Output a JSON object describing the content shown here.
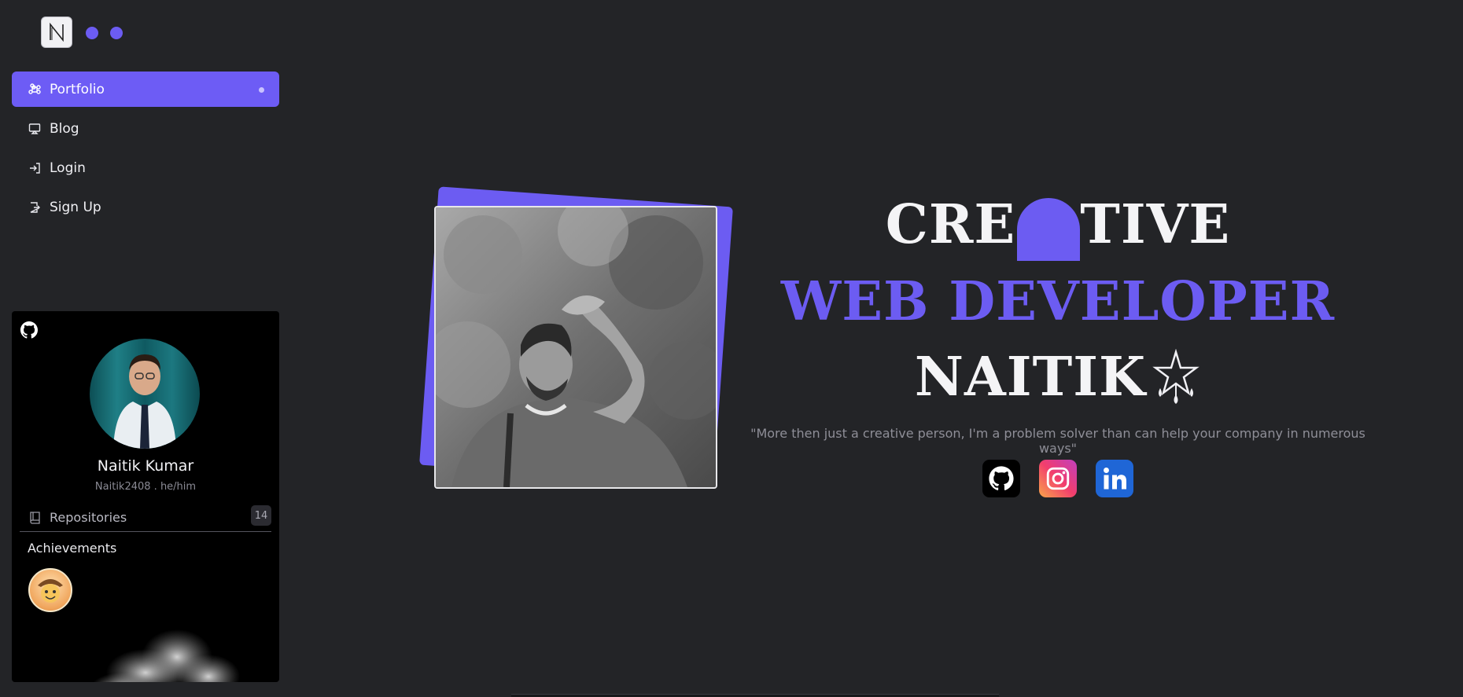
{
  "colors": {
    "background": "#232427",
    "accent": "#6c5cf2",
    "card_bg": "#000000"
  },
  "logo": {
    "letter": "N",
    "icon": "n-logo-icon"
  },
  "nav": {
    "items": [
      {
        "label": "Portfolio",
        "icon": "command-icon",
        "active": true
      },
      {
        "label": "Blog",
        "icon": "monitor-icon",
        "active": false
      },
      {
        "label": "Login",
        "icon": "login-icon",
        "active": false
      },
      {
        "label": "Sign Up",
        "icon": "signup-icon",
        "active": false
      }
    ]
  },
  "profile": {
    "name": "Naitik Kumar",
    "handle": "Naitik2408 . he/him",
    "repositories_label": "Repositories",
    "repositories_count": "14",
    "achievements_title": "Achievements"
  },
  "hero": {
    "line1_left": "CRE",
    "line1_right": "TIVE",
    "line2": "WEB DEVELOPER",
    "line3": "NAITIK",
    "quote": "\"More then just a creative person, I'm a problem solver than can help your company in numerous ways\""
  },
  "socials": [
    {
      "name": "github",
      "icon": "github-icon"
    },
    {
      "name": "instagram",
      "icon": "instagram-icon"
    },
    {
      "name": "linkedin",
      "icon": "linkedin-icon"
    }
  ]
}
